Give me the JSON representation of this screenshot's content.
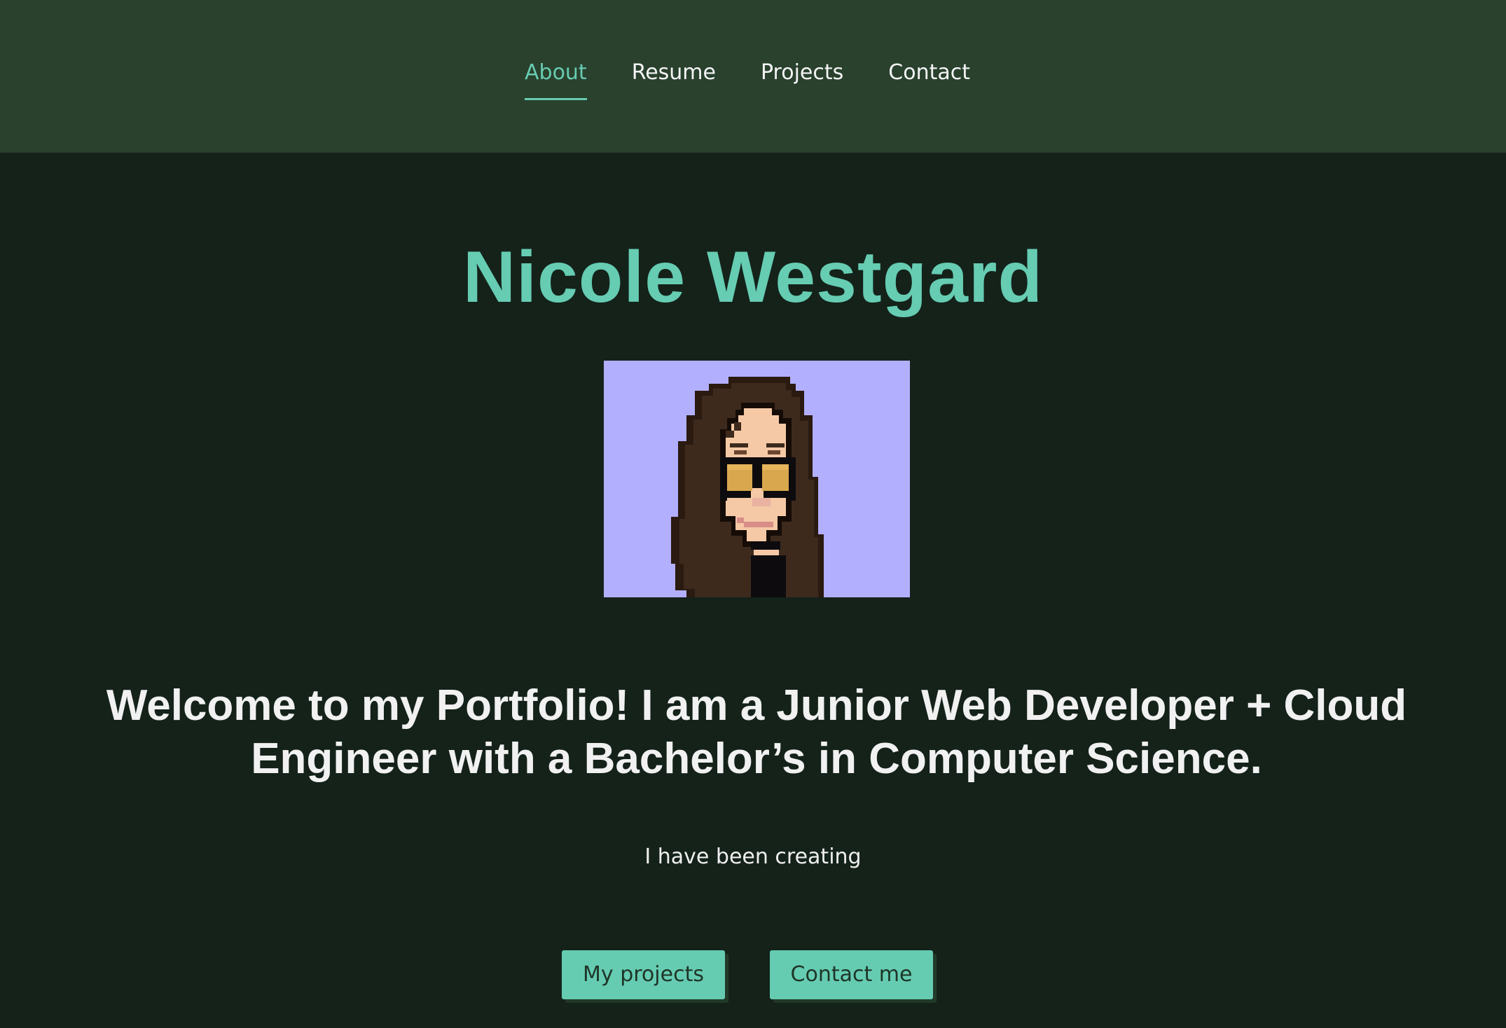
{
  "nav": {
    "items": [
      {
        "label": "About",
        "active": true
      },
      {
        "label": "Resume",
        "active": false
      },
      {
        "label": "Projects",
        "active": false
      },
      {
        "label": "Contact",
        "active": false
      }
    ]
  },
  "hero": {
    "name": "Nicole Westgard",
    "headline": "Welcome to my Portfolio! I am a Junior Web Developer + Cloud Engineer with a Bachelor’s in Computer Science.",
    "subtext": "I have been creating"
  },
  "avatar": {
    "icon": "pixel-art-avatar-icon"
  },
  "buttons": {
    "projects_label": "My projects",
    "contact_label": "Contact me"
  },
  "colors": {
    "accent": "#66ccb2",
    "header_bg": "#29412d",
    "page_bg": "#14221a",
    "avatar_bg": "#b3afff"
  }
}
